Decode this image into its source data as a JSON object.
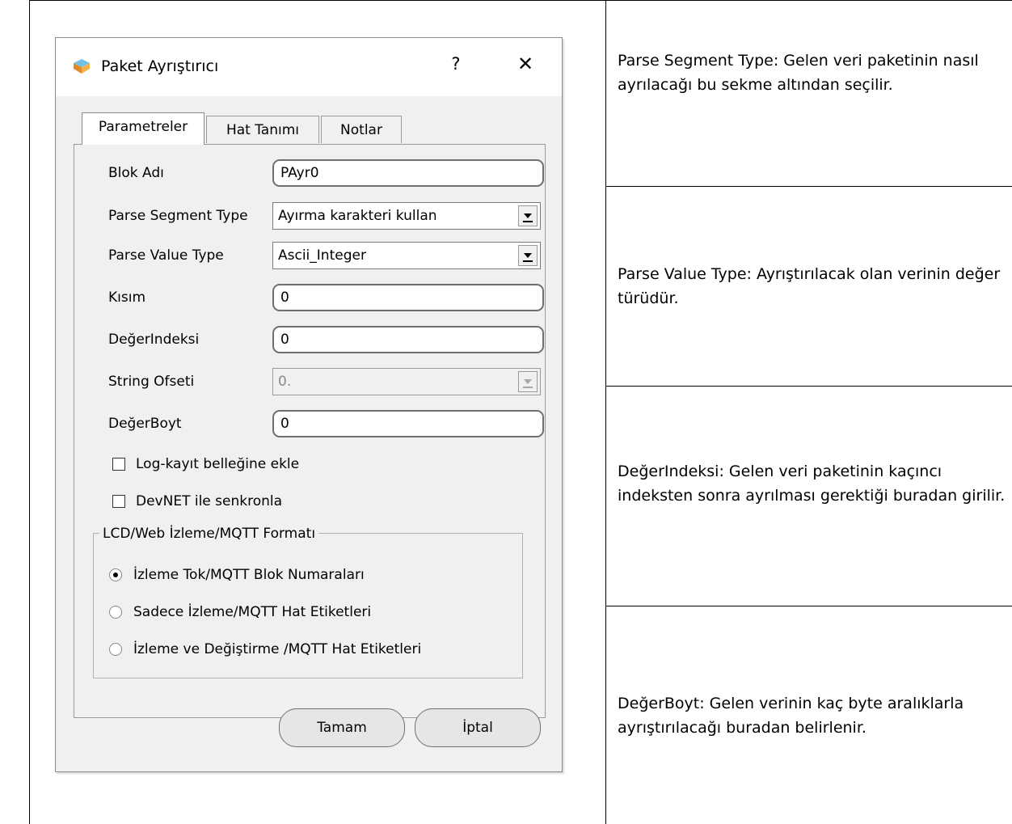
{
  "dialog": {
    "title": "Paket Ayrıştırıcı",
    "help_label": "?",
    "close_label": "✕",
    "tabs": [
      {
        "label": "Parametreler",
        "active": true
      },
      {
        "label": "Hat Tanımı",
        "active": false
      },
      {
        "label": "Notlar",
        "active": false
      }
    ],
    "fields": {
      "blok_adi": {
        "label": "Blok Adı",
        "value": "PAyr0"
      },
      "parse_segment_type": {
        "label": "Parse Segment Type",
        "value": "Ayırma karakteri kullan"
      },
      "parse_value_type": {
        "label": "Parse Value Type",
        "value": "Ascii_Integer"
      },
      "kisim": {
        "label": "Kısım",
        "value": "0"
      },
      "deger_indeksi": {
        "label": "DeğerIndeksi",
        "value": "0"
      },
      "string_ofseti": {
        "label": "String Ofseti",
        "value": "0.",
        "disabled": true
      },
      "deger_boyt": {
        "label": "DeğerBoyt",
        "value": "0"
      }
    },
    "checkboxes": [
      {
        "label": "Log-kayıt belleğine ekle",
        "checked": false
      },
      {
        "label": "DevNET ile senkronla",
        "checked": false
      }
    ],
    "group": {
      "title": "LCD/Web İzleme/MQTT Formatı",
      "options": [
        {
          "label": "İzleme Tok/MQTT Blok Numaraları",
          "selected": true
        },
        {
          "label": "Sadece İzleme/MQTT Hat Etiketleri",
          "selected": false
        },
        {
          "label": "İzleme ve Değiştirme /MQTT Hat Etiketleri",
          "selected": false
        }
      ]
    },
    "buttons": {
      "ok": "Tamam",
      "cancel": "İptal"
    }
  },
  "descriptions": [
    "Parse Segment Type:  Gelen veri paketinin nasıl ayrılacağı bu sekme altından seçilir.",
    "Parse Value Type:  Ayrıştırılacak olan verinin değer türüdür.",
    "DeğerIndeksi:  Gelen veri paketinin kaçıncı indeksten sonra ayrılması gerektiği buradan girilir.",
    "DeğerBoyt:  Gelen verinin kaç byte aralıklarla ayrıştırılacağı buradan belirlenir."
  ],
  "colors": {
    "dialog_bg": "#f0f0f0",
    "titlebar_bg": "#ffffff",
    "border": "#000000"
  }
}
